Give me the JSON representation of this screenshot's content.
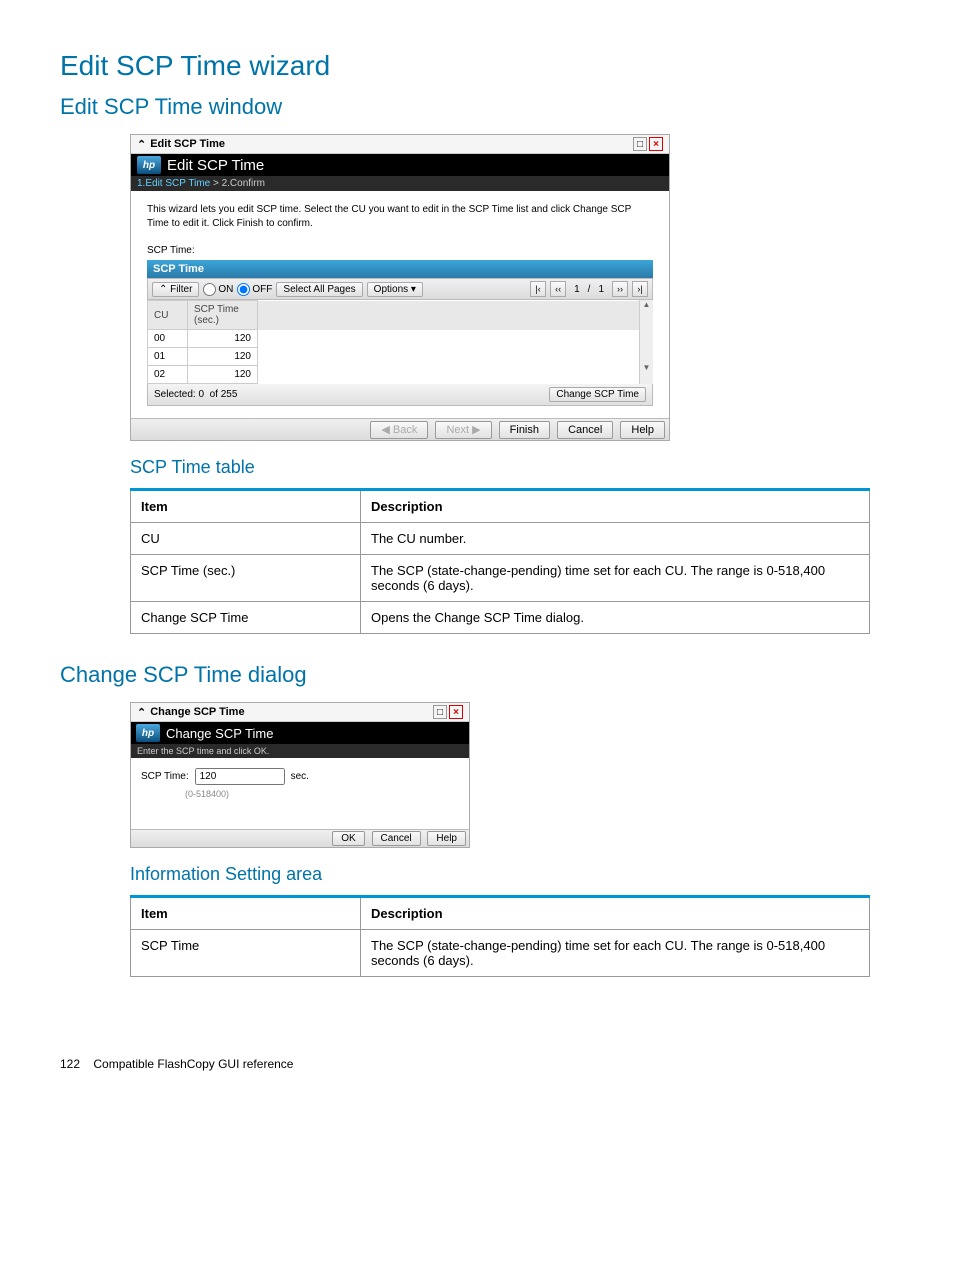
{
  "page": {
    "h1": "Edit SCP Time wizard",
    "h2a": "Edit SCP Time window",
    "h3a": "SCP Time table",
    "h2b": "Change SCP Time dialog",
    "h3b": "Information Setting area",
    "footer_page": "122",
    "footer_text": "Compatible FlashCopy GUI reference"
  },
  "wizard": {
    "titlebar": "Edit SCP Time",
    "header": "Edit SCP Time",
    "step_active": "1.Edit SCP Time",
    "step_sep": ">",
    "step_next": "2.Confirm",
    "instruction": "This wizard lets you edit SCP time. Select the CU you want to edit in the SCP Time list and click Change SCP Time to edit it. Click Finish to confirm.",
    "label_scptime": "SCP Time:",
    "grid_title": "SCP Time",
    "toolbar": {
      "filter": "Filter",
      "on": "ON",
      "off": "OFF",
      "select_all": "Select All Pages",
      "options": "Options",
      "page_current": "1",
      "page_sep": "/",
      "page_total": "1"
    },
    "columns": {
      "cu": "CU",
      "scp": "SCP Time (sec.)"
    },
    "rows": [
      {
        "cu": "00",
        "scp": "120"
      },
      {
        "cu": "01",
        "scp": "120"
      },
      {
        "cu": "02",
        "scp": "120"
      }
    ],
    "selected_label": "Selected:",
    "selected_count": "0",
    "of_label": "of",
    "total_count": "255",
    "change_btn": "Change SCP Time",
    "btn_back": "◀ Back",
    "btn_next": "Next ▶",
    "btn_finish": "Finish",
    "btn_cancel": "Cancel",
    "btn_help": "Help"
  },
  "scp_table": {
    "h_item": "Item",
    "h_desc": "Description",
    "rows": [
      {
        "item": "CU",
        "desc": "The CU number."
      },
      {
        "item": "SCP Time (sec.)",
        "desc": "The SCP (state-change-pending) time set for each CU. The range is 0-518,400 seconds (6 days)."
      },
      {
        "item": "Change SCP Time",
        "desc": "Opens the Change SCP Time dialog."
      }
    ]
  },
  "dialog2": {
    "titlebar": "Change SCP Time",
    "header": "Change SCP Time",
    "subheader": "Enter the SCP time and click OK.",
    "field_label": "SCP Time:",
    "field_value": "120",
    "unit": "sec.",
    "hint": "(0-518400)",
    "btn_ok": "OK",
    "btn_cancel": "Cancel",
    "btn_help": "Help"
  },
  "info_table": {
    "h_item": "Item",
    "h_desc": "Description",
    "rows": [
      {
        "item": "SCP Time",
        "desc": "The SCP (state-change-pending) time set for each CU. The range is 0-518,400 seconds (6 days)."
      }
    ]
  }
}
